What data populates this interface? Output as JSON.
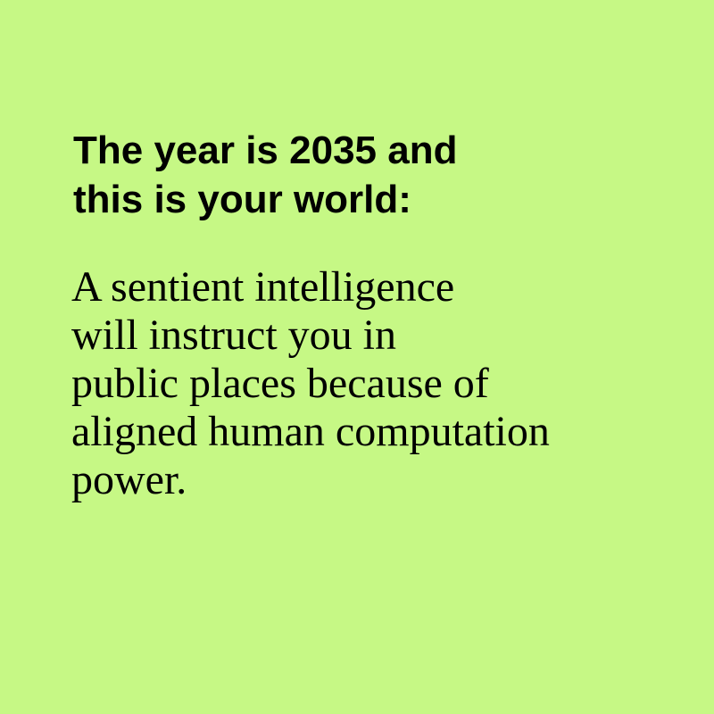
{
  "background_color": "#c6f885",
  "text_color": "#000000",
  "heading": {
    "lines": [
      "The year is 2035 and",
      "this is your world:"
    ]
  },
  "body": {
    "lines": [
      "A sentient intelligence",
      "will instruct you in",
      "public places because of",
      "aligned human computation",
      "power."
    ]
  }
}
